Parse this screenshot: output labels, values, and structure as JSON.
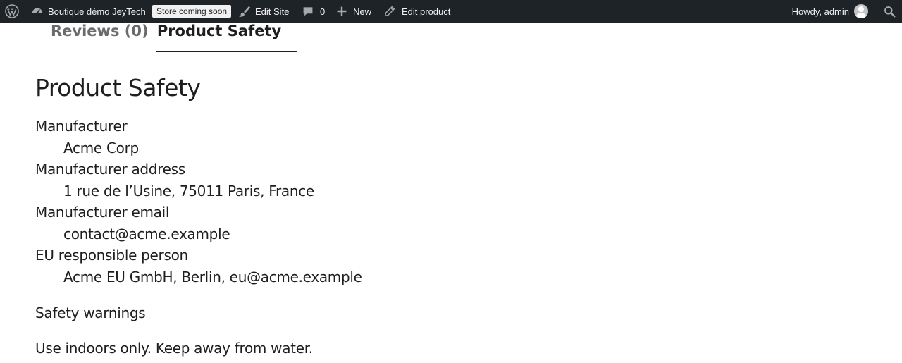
{
  "admin_bar": {
    "wp_logo_icon": "wordpress-logo-icon",
    "site_name": "Boutique démo JeyTech",
    "site_icon": "dashboard-icon",
    "store_badge": "Store coming soon",
    "edit_site": "Edit Site",
    "edit_site_icon": "brush-icon",
    "comments_count": "0",
    "comments_icon": "comment-bubble-icon",
    "new_label": "New",
    "new_icon": "plus-icon",
    "edit_product": "Edit product",
    "edit_product_icon": "pencil-icon",
    "howdy": "Howdy, admin",
    "search_icon": "search-icon"
  },
  "tabs": [
    {
      "label": "Reviews (0)",
      "active": false
    },
    {
      "label": "Product Safety",
      "active": true
    }
  ],
  "product_safety": {
    "title": "Product Safety",
    "fields": [
      {
        "label": "Manufacturer",
        "value": "Acme Corp"
      },
      {
        "label": "Manufacturer address",
        "value": "1 rue de l’Usine, 75011 Paris, France"
      },
      {
        "label": "Manufacturer email",
        "value": "contact@acme.example"
      },
      {
        "label": "EU responsible person",
        "value": "Acme EU GmbH, Berlin, eu@acme.example"
      }
    ],
    "warnings_title": "Safety warnings",
    "warnings_text": "Use indoors only. Keep away from water."
  }
}
